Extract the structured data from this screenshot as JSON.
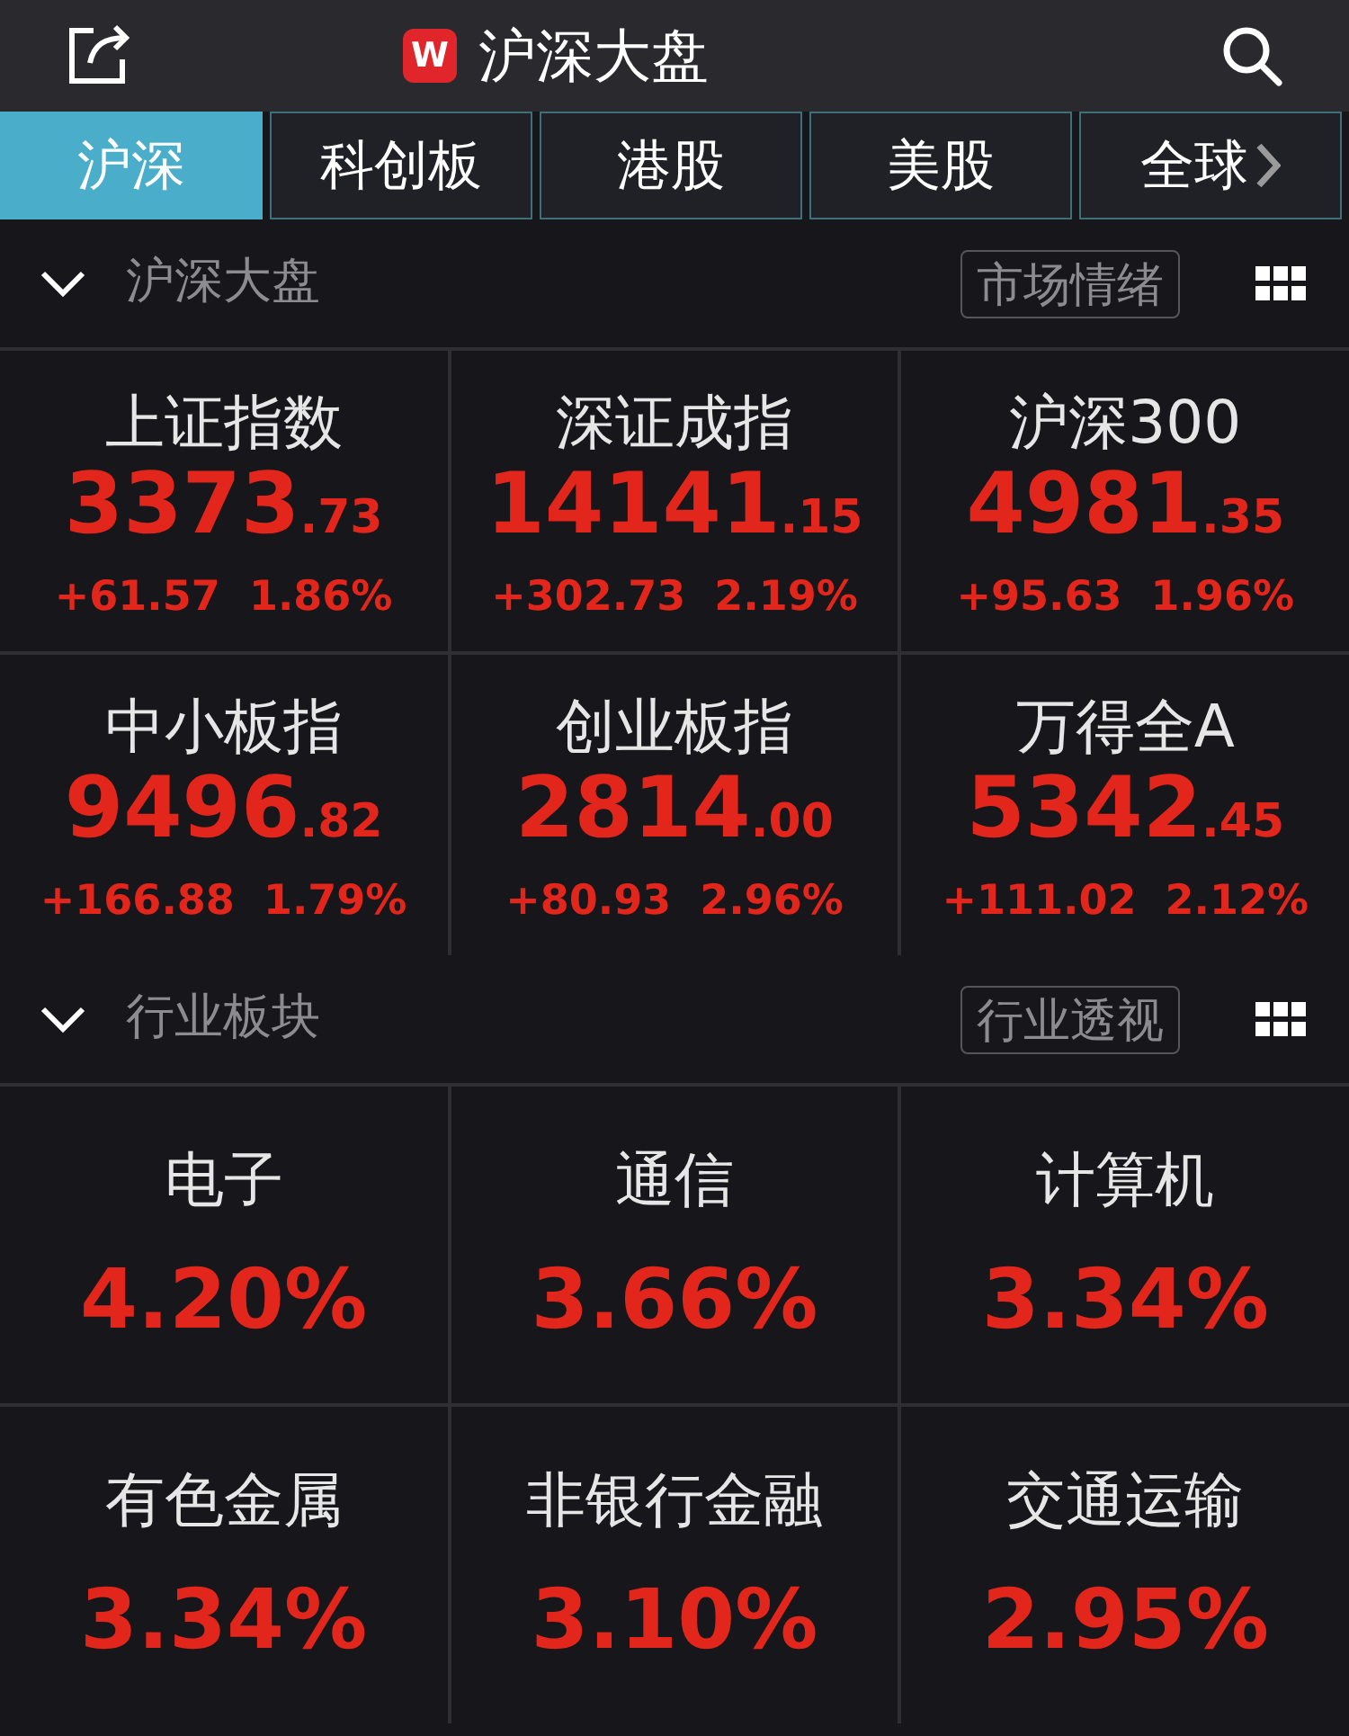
{
  "header": {
    "logo": "W",
    "title": "沪深大盘"
  },
  "tabs": [
    {
      "label": "沪深",
      "selected": true
    },
    {
      "label": "科创板",
      "selected": false
    },
    {
      "label": "港股",
      "selected": false
    },
    {
      "label": "美股",
      "selected": false
    },
    {
      "label": "全球",
      "selected": false
    }
  ],
  "sections": [
    {
      "title": "沪深大盘",
      "expanded": true,
      "action": "市场情绪",
      "kind": "index",
      "items": [
        {
          "name": "上证指数",
          "integer": "3373",
          "decimal": ".73",
          "change": "+61.57",
          "percent": "1.86%"
        },
        {
          "name": "深证成指",
          "integer": "14141",
          "decimal": ".15",
          "change": "+302.73",
          "percent": "2.19%"
        },
        {
          "name": "沪深300",
          "integer": "4981",
          "decimal": ".35",
          "change": "+95.63",
          "percent": "1.96%"
        },
        {
          "name": "中小板指",
          "integer": "9496",
          "decimal": ".82",
          "change": "+166.88",
          "percent": "1.79%"
        },
        {
          "name": "创业板指",
          "integer": "2814",
          "decimal": ".00",
          "change": "+80.93",
          "percent": "2.96%"
        },
        {
          "name": "万得全A",
          "integer": "5342",
          "decimal": ".45",
          "change": "+111.02",
          "percent": "2.12%"
        }
      ]
    },
    {
      "title": "行业板块",
      "expanded": true,
      "action": "行业透视",
      "kind": "sector",
      "items": [
        {
          "name": "电子",
          "percent": "4.20%"
        },
        {
          "name": "通信",
          "percent": "3.66%"
        },
        {
          "name": "计算机",
          "percent": "3.34%"
        },
        {
          "name": "有色金属",
          "percent": "3.34%"
        },
        {
          "name": "非银行金融",
          "percent": "3.10%"
        },
        {
          "name": "交通运输",
          "percent": "2.95%"
        }
      ]
    }
  ]
}
